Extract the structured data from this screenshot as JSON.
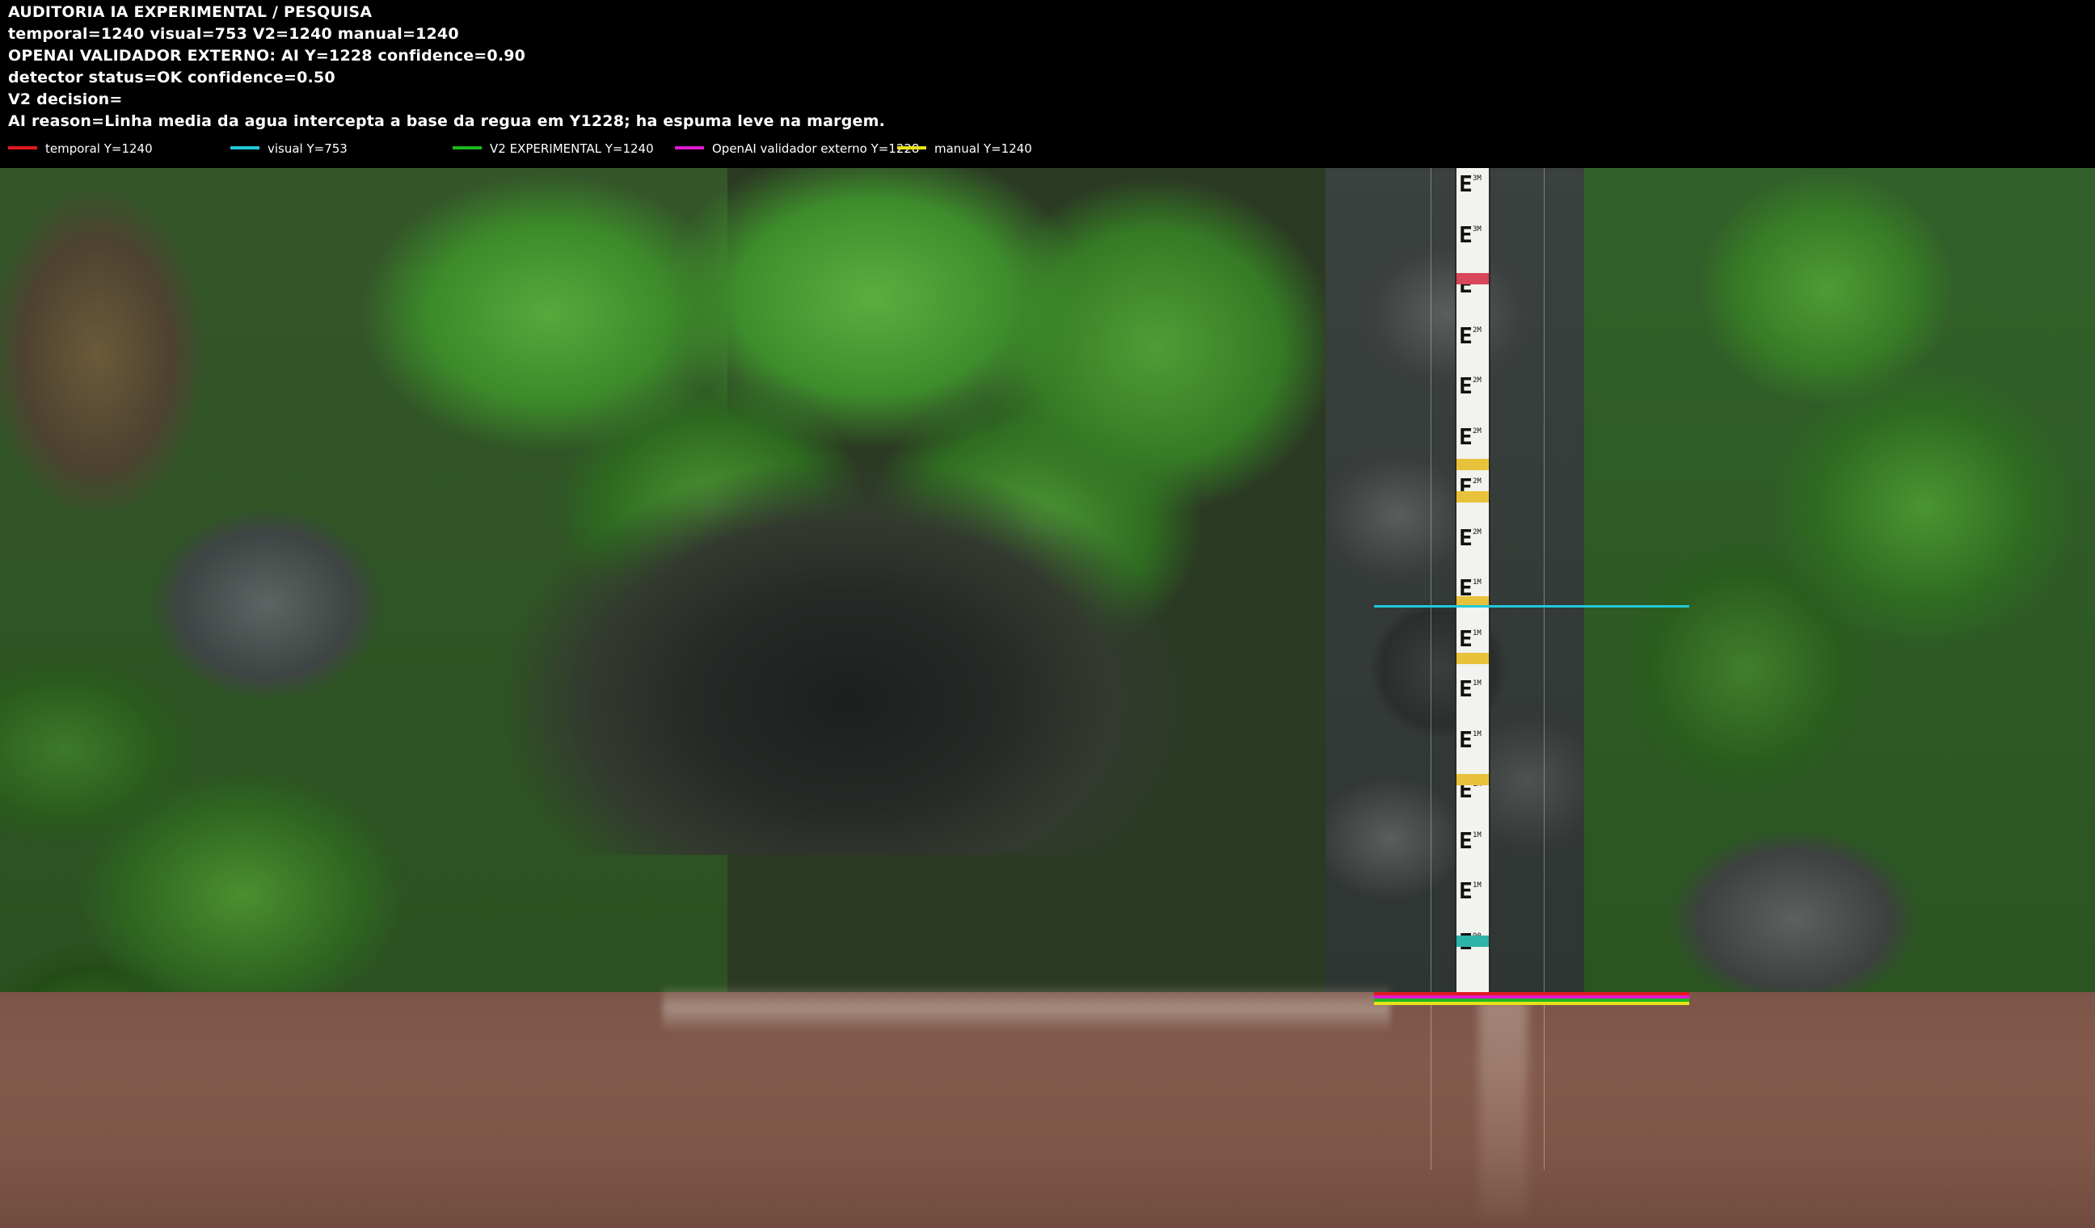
{
  "header": {
    "line1": "AUDITORIA IA  EXPERIMENTAL / PESQUISA",
    "line2": "temporal=1240  visual=753  V2=1240  manual=1240",
    "line3": "OPENAI  VALIDADOR EXTERNO: AI Y=1228  confidence=0.90",
    "line4": "detector status=OK confidence=0.50",
    "line5": "V2 decision=",
    "line6": "AI reason=Linha media da agua intercepta a base da regua em Y1228; ha espuma leve na margem."
  },
  "legend": [
    {
      "label": "temporal Y=1240",
      "color": "#e0191f"
    },
    {
      "label": "visual Y=753",
      "color": "#21c8d8"
    },
    {
      "label": "V2 EXPERIMENTAL Y=1240",
      "color": "#1db81d"
    },
    {
      "label": "OpenAI validador externo Y=1228",
      "color": "#e01bd0"
    },
    {
      "label": "manual Y=1240",
      "color": "#e8e21a"
    }
  ],
  "gauge": {
    "labels": [
      "3M",
      "3M",
      "3M",
      "2M",
      "2M",
      "2M",
      "2M",
      "2M",
      "1M",
      "1M",
      "1M",
      "1M",
      "1M",
      "1M",
      "1M",
      "90"
    ],
    "band_colors": [
      "#d9465a",
      "#e8c23a",
      "#e8c23a",
      "#e8c23a",
      "#e8c23a",
      "#e8c23a",
      "#2eb3a8"
    ]
  },
  "overlay": {
    "visual_color": "#21c8d8",
    "temporal_color": "#e0191f",
    "manual_color": "#e8e21a",
    "openai_color": "#e01bd0",
    "v2_color": "#1db81d"
  }
}
